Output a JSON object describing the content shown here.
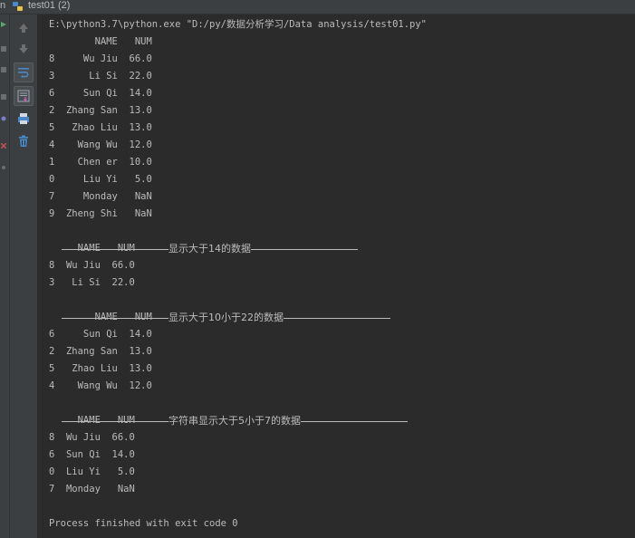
{
  "tab": {
    "prefix": "n",
    "label": "test01 (2)"
  },
  "console": {
    "command": "E:\\python3.7\\python.exe \"D:/py/数据分析学习/Data analysis/test01.py\"",
    "table1_header": "        NAME   NUM",
    "table1_rows": [
      "8     Wu Jiu  66.0",
      "3      Li Si  22.0",
      "6     Sun Qi  14.0",
      "2  Zhang San  13.0",
      "5   Zhao Liu  13.0",
      "4    Wang Wu  12.0",
      "1    Chen er  10.0",
      "0     Liu Yi   5.0",
      "7     Monday   NaN",
      "9  Zheng Shi   NaN"
    ],
    "sep1": "显示大于14的数据",
    "table2_header": "     NAME   NUM",
    "table2_rows": [
      "8  Wu Jiu  66.0",
      "3   Li Si  22.0"
    ],
    "sep2": "显示大于10小于22的数据",
    "table3_header": "        NAME   NUM",
    "table3_rows": [
      "6     Sun Qi  14.0",
      "2  Zhang San  13.0",
      "5   Zhao Liu  13.0",
      "4    Wang Wu  12.0"
    ],
    "sep3": "字符串显示大于5小于7的数据",
    "table4_header": "     NAME   NUM",
    "table4_rows": [
      "8  Wu Jiu  66.0",
      "6  Sun Qi  14.0",
      "0  Liu Yi   5.0",
      "7  Monday   NaN"
    ],
    "exit": "Process finished with exit code 0"
  },
  "toolbar": {
    "icons": [
      "arrow-up-icon",
      "arrow-down-icon",
      "soft-wrap-icon",
      "scroll-to-end-icon",
      "print-icon",
      "trash-icon"
    ]
  },
  "colors": {
    "background": "#2b2b2b",
    "panel": "#3c3f41",
    "text": "#bbbbbb",
    "accent_blue": "#4a88c7",
    "python_yellow": "#e8c44a"
  }
}
